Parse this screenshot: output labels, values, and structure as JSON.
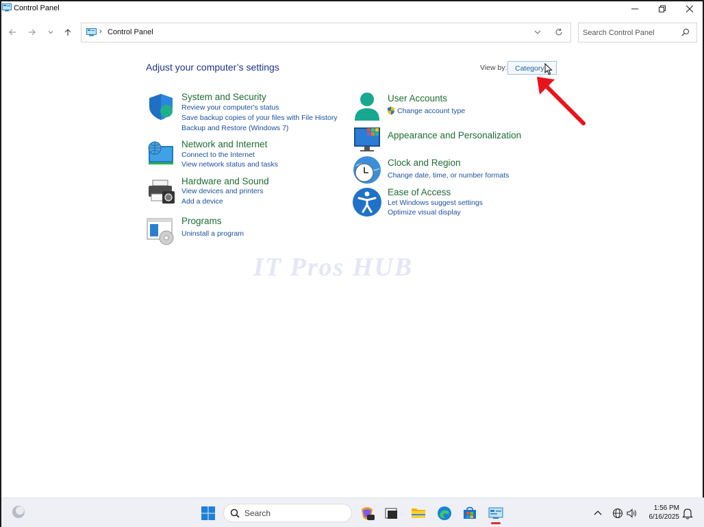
{
  "window": {
    "title": "Control Panel"
  },
  "address": {
    "separator": "›",
    "breadcrumb": "Control Panel"
  },
  "search": {
    "placeholder": "Search Control Panel"
  },
  "content": {
    "heading": "Adjust your computer’s settings",
    "view_by_label": "View by:",
    "view_by_value": "Category"
  },
  "categories_left": [
    {
      "title": "System and Security",
      "icon": "shield-icon",
      "links": [
        "Review your computer's status",
        "Save backup copies of your files with File History",
        "Backup and Restore (Windows 7)"
      ]
    },
    {
      "title": "Network and Internet",
      "icon": "network-icon",
      "links": [
        "Connect to the Internet",
        "View network status and tasks"
      ]
    },
    {
      "title": "Hardware and Sound",
      "icon": "printer-icon",
      "links": [
        "View devices and printers",
        "Add a device"
      ]
    },
    {
      "title": "Programs",
      "icon": "programs-icon",
      "links": [
        "Uninstall a program"
      ]
    }
  ],
  "categories_right": [
    {
      "title": "User Accounts",
      "icon": "user-icon",
      "links": [
        "Change account type"
      ]
    },
    {
      "title": "Appearance and Personalization",
      "icon": "appearance-icon",
      "links": []
    },
    {
      "title": "Clock and Region",
      "icon": "clock-icon",
      "links": [
        "Change date, time, or number formats"
      ]
    },
    {
      "title": "Ease of Access",
      "icon": "accessibility-icon",
      "links": [
        "Let Windows suggest settings",
        "Optimize visual display"
      ]
    }
  ],
  "watermark": "IT Pros HUB",
  "taskbar": {
    "search_label": "Search",
    "time": "1:56 PM",
    "date": "6/16/2025"
  },
  "colors": {
    "heading": "#1e3287",
    "category_title": "#1e6b32",
    "link": "#1a4f9c",
    "annotation_arrow": "#e8141b"
  }
}
